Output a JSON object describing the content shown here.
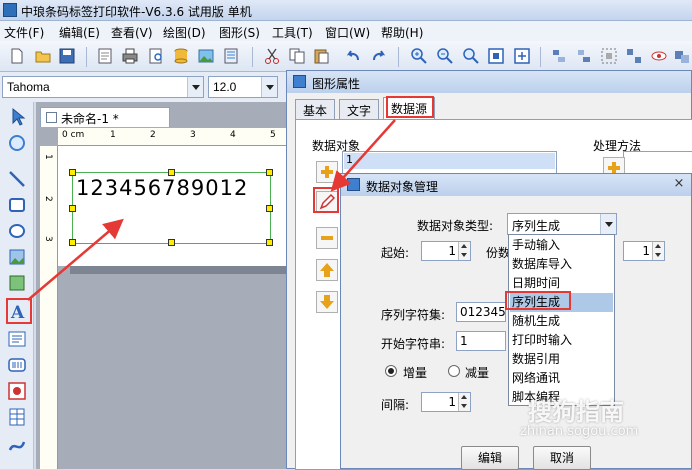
{
  "app": {
    "title": "中琅条码标签打印软件-V6.3.6 试用版 单机"
  },
  "menu": [
    "文件(F)",
    "编辑(E)",
    "查看(V)",
    "绘图(D)",
    "图形(S)",
    "工具(T)",
    "窗口(W)",
    "帮助(H)"
  ],
  "fontbar": {
    "font": "Tahoma",
    "size": "12.0"
  },
  "document": {
    "tab": "未命名-1 *",
    "ruler_h": [
      "0 cm",
      "1",
      "2",
      "3",
      "4",
      "5"
    ],
    "ruler_v": [
      "1",
      "2",
      "3"
    ],
    "barcode_text": "123456789012"
  },
  "properties": {
    "title": "图形属性",
    "tabs": [
      "基本",
      "文字",
      "数据源"
    ],
    "data_objects_label": "数据对象",
    "data_list_first": "1",
    "processing_label": "处理方法"
  },
  "dialog": {
    "title": "数据对象管理",
    "close": "×",
    "type_label": "数据对象类型:",
    "type_value": "序列生成",
    "start_label": "起始:",
    "start_value": "1",
    "copies_label": "份数",
    "copies_value": "1",
    "charset_label": "序列字符集:",
    "charset_value": "0123456",
    "start_str_label": "开始字符串:",
    "start_str_value": "1",
    "increase_label": "增量",
    "decrease_label": "减量",
    "interval_label": "间隔:",
    "interval_value": "1",
    "edit_button": "编辑",
    "cancel_button": "取消"
  },
  "dropdown": {
    "options": [
      "手动输入",
      "数据库导入",
      "日期时间",
      "序列生成",
      "随机生成",
      "打印时输入",
      "数据引用",
      "网络通讯",
      "脚本编程"
    ],
    "selected_index": 3
  },
  "watermark": {
    "main": "搜狗指南",
    "url": "zhinan.sogou.com"
  },
  "colors": {
    "highlight": "#e53935",
    "selection": "#aec8e8",
    "accent": "#3e7fcf"
  }
}
